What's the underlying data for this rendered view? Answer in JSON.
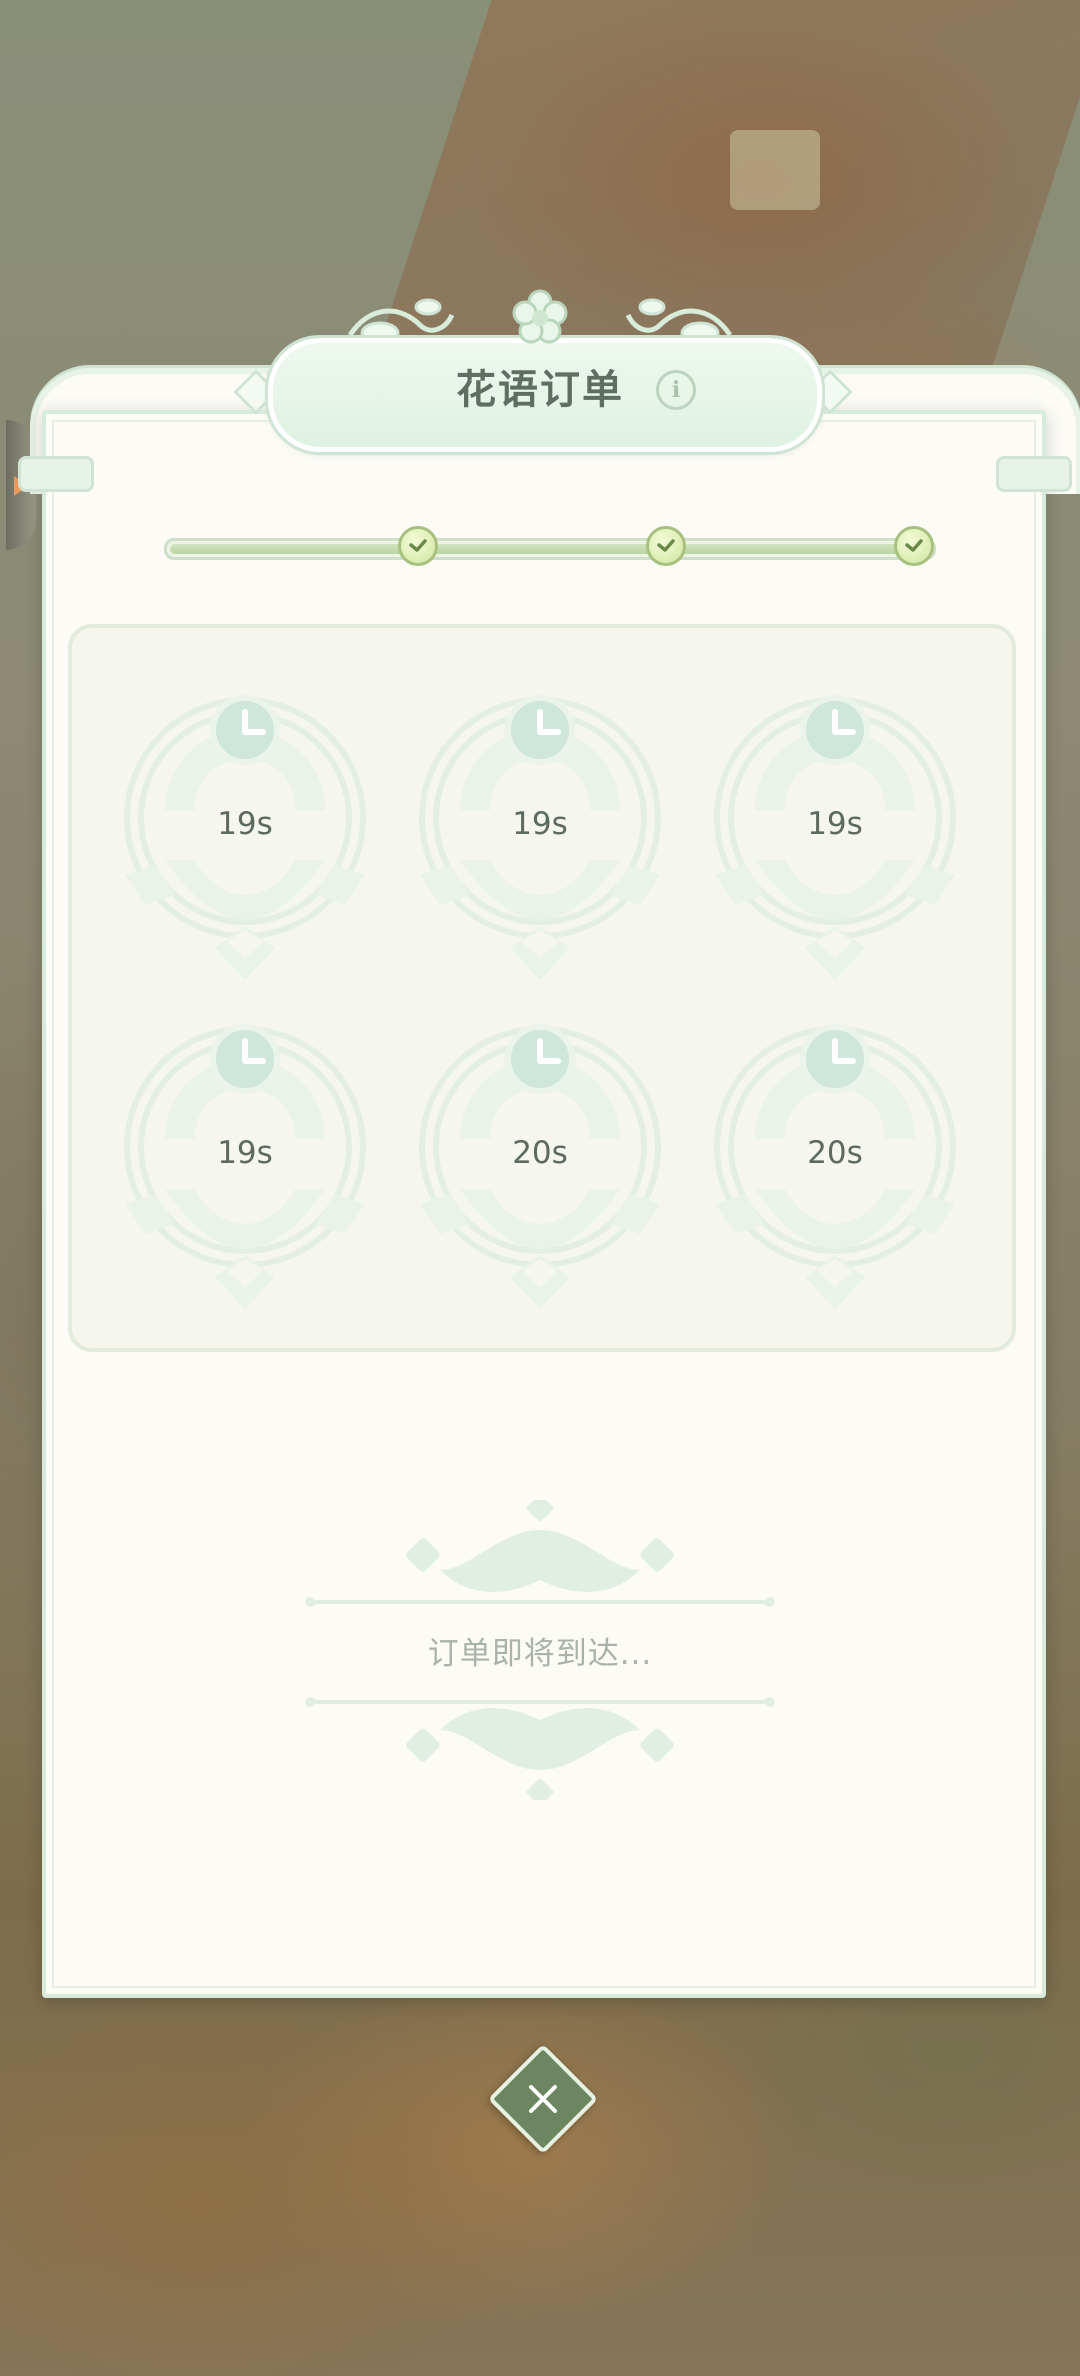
{
  "title": "花语订单",
  "progress": {
    "milestones_completed": 3,
    "milestones_total": 3,
    "fill_fraction": 1.0
  },
  "orders": [
    {
      "time": "19s"
    },
    {
      "time": "19s"
    },
    {
      "time": "19s"
    },
    {
      "time": "19s"
    },
    {
      "time": "20s"
    },
    {
      "time": "20s"
    }
  ],
  "waiting_text": "订单即将到达...",
  "icons": {
    "info": "info-icon",
    "close": "close-icon",
    "clock": "clock-icon",
    "milestone": "check-icon"
  },
  "colors": {
    "panel": "#fcfbf6",
    "accent_green": "#6b8660",
    "title_text": "#5f6e62"
  }
}
